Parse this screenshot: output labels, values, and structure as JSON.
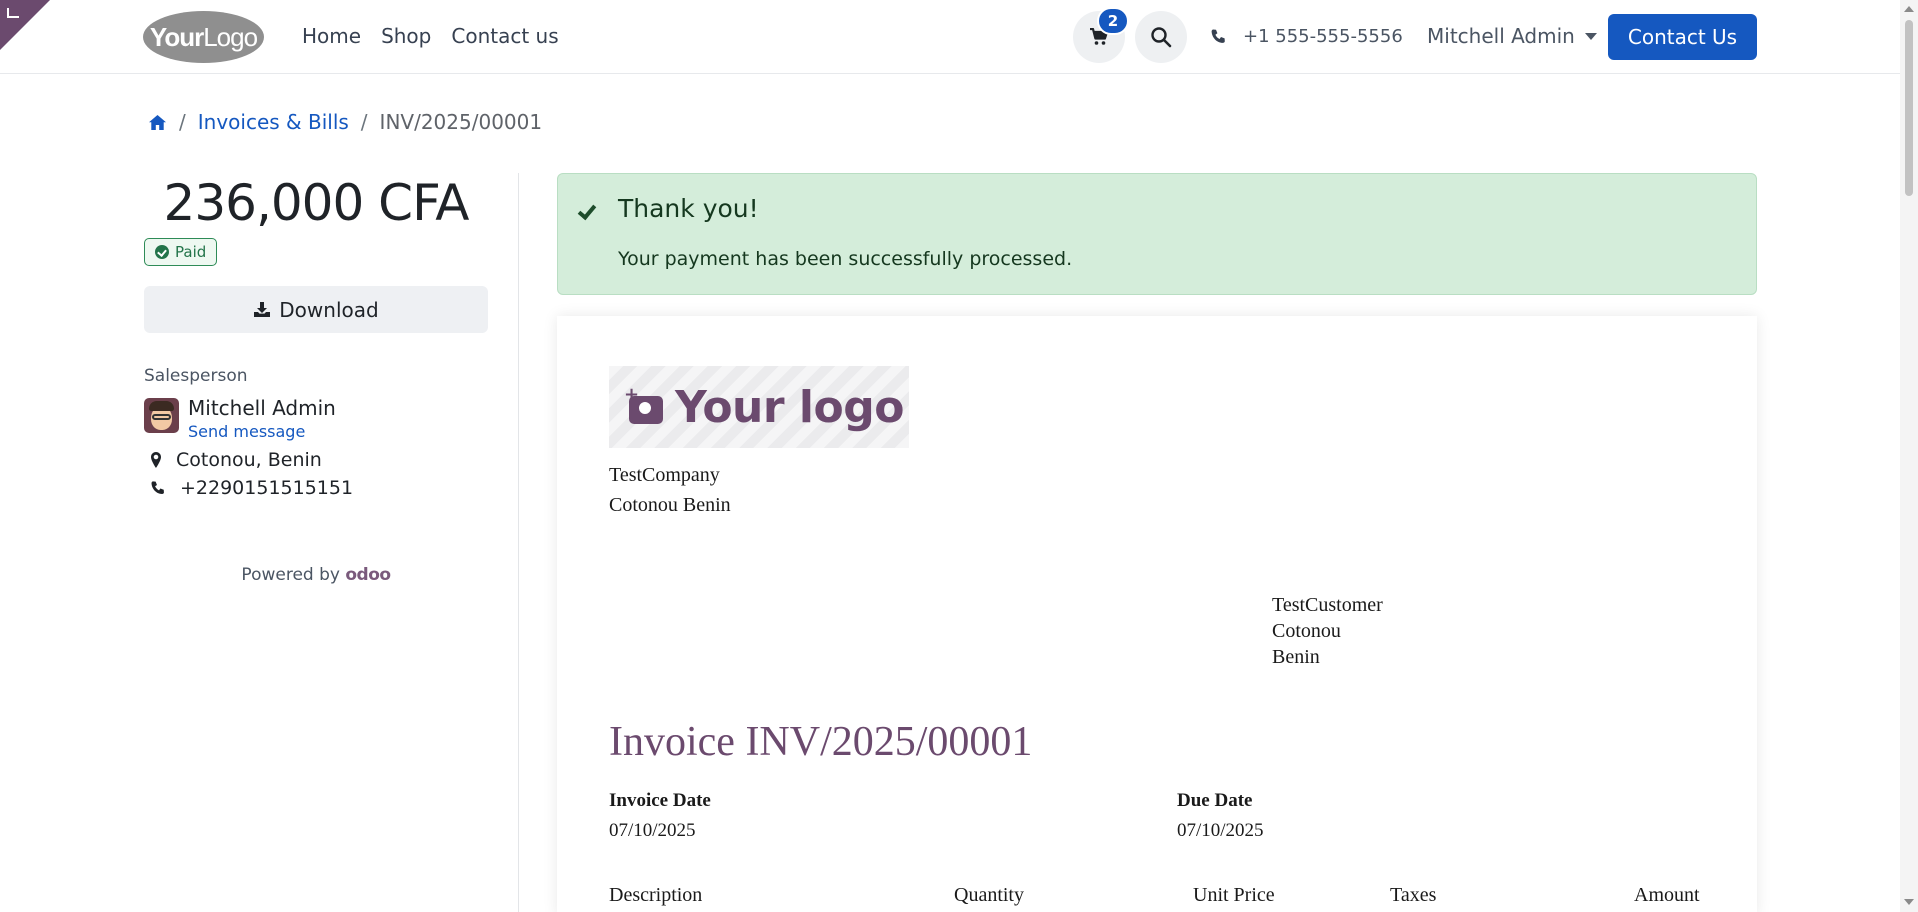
{
  "header": {
    "logo": {
      "bold": "Your",
      "light": "Logo"
    },
    "nav": [
      "Home",
      "Shop",
      "Contact us"
    ],
    "cart_count": "2",
    "phone": "+1 555-555-5556",
    "user": "Mitchell Admin",
    "cta": "Contact Us",
    "accent_color": "#1558c0"
  },
  "breadcrumb": {
    "home_icon": "home-icon",
    "items": [
      "Invoices & Bills",
      "INV/2025/00001"
    ]
  },
  "sidebar": {
    "amount": "236,000 CFA",
    "status": "Paid",
    "download_label": "Download",
    "salesperson_label": "Salesperson",
    "salesperson_name": "Mitchell Admin",
    "send_message": "Send message",
    "location": "Cotonou, Benin",
    "phone": "+2290151515151",
    "powered_by": "Powered by",
    "powered_brand": "odoo"
  },
  "alert": {
    "title": "Thank you!",
    "message": "Your payment has been successfully processed."
  },
  "invoice": {
    "logo_text": "Your logo",
    "company_lines": [
      "TestCompany",
      "Cotonou Benin"
    ],
    "customer_lines": [
      "TestCustomer",
      "Cotonou",
      "Benin"
    ],
    "title": "Invoice INV/2025/00001",
    "invoice_date_label": "Invoice Date",
    "invoice_date": "07/10/2025",
    "due_date_label": "Due Date",
    "due_date": "07/10/2025",
    "columns": [
      "Description",
      "Quantity",
      "Unit Price",
      "Taxes",
      "Amount"
    ]
  }
}
